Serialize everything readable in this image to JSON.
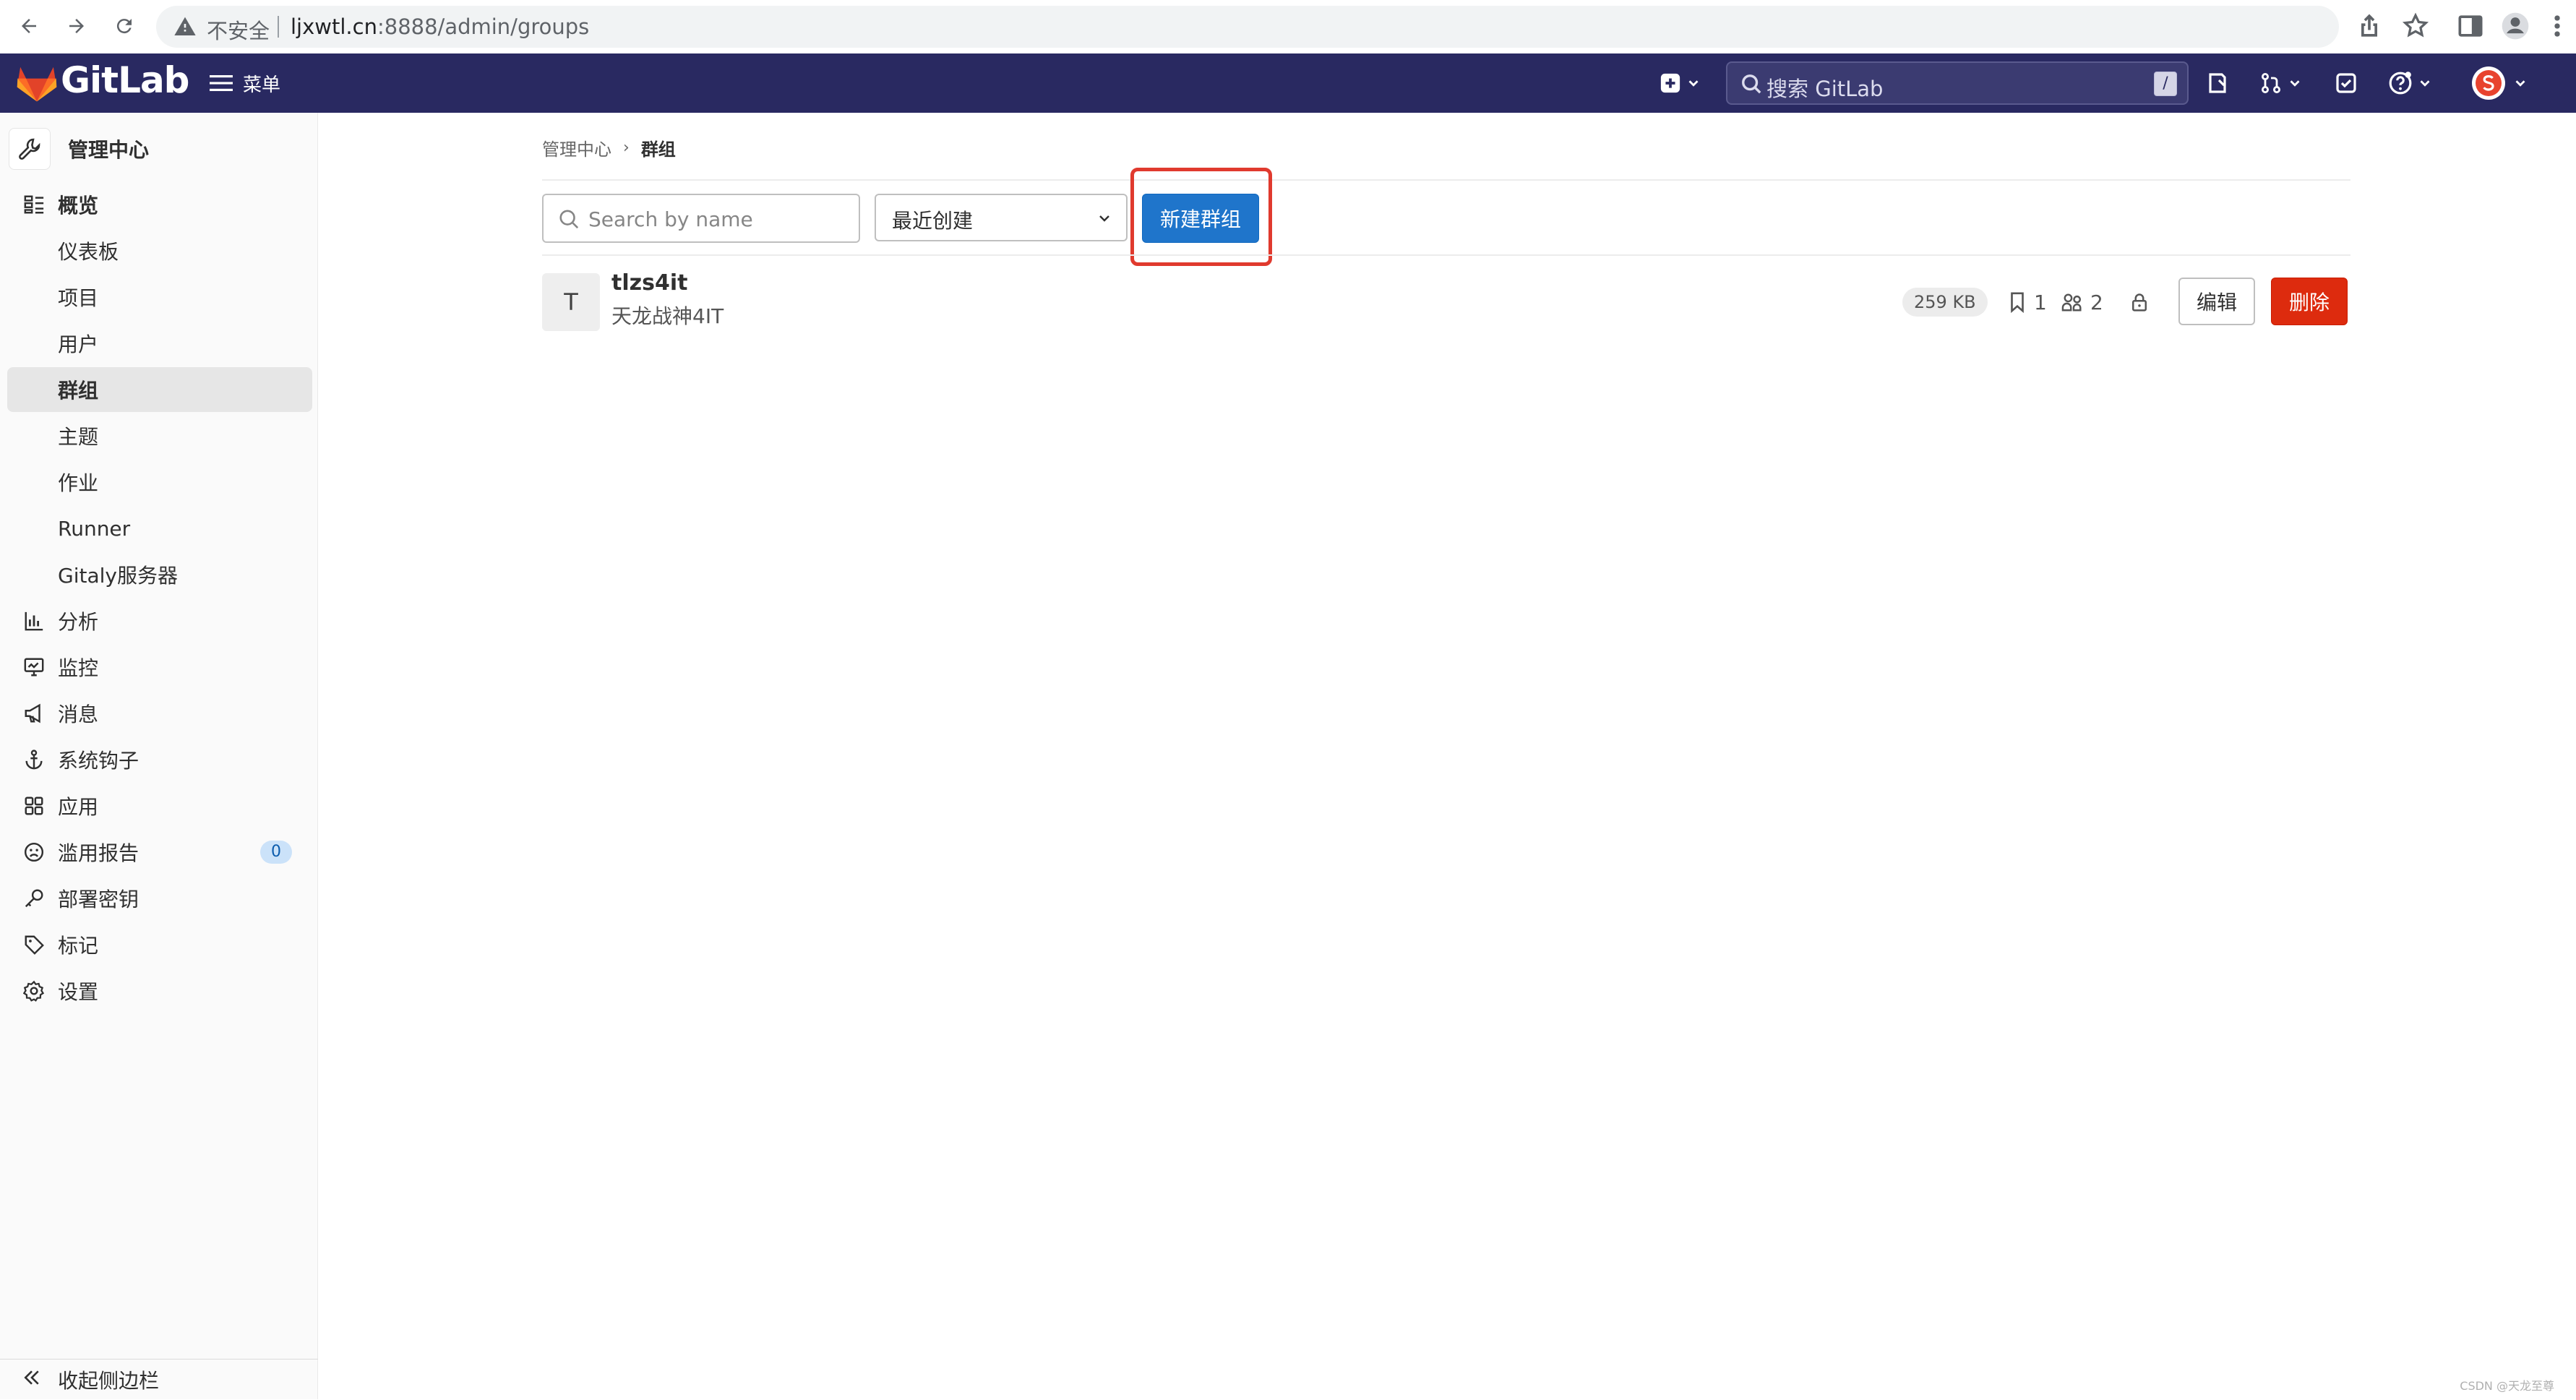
{
  "browser": {
    "security_label": "不安全",
    "url_host": "ljxwtl.cn",
    "url_rest": ":8888/admin/groups"
  },
  "header": {
    "logo_text": "GitLab",
    "menu_label": "菜单",
    "search_placeholder": "搜索 GitLab",
    "search_shortcut": "/",
    "brand_color": "#292961"
  },
  "sidebar": {
    "context_label": "管理中心",
    "items": [
      {
        "label": "概览",
        "icon": "overview-icon",
        "type": "section"
      },
      {
        "label": "仪表板",
        "type": "sub"
      },
      {
        "label": "项目",
        "type": "sub"
      },
      {
        "label": "用户",
        "type": "sub"
      },
      {
        "label": "群组",
        "type": "sub",
        "active": true
      },
      {
        "label": "主题",
        "type": "sub"
      },
      {
        "label": "作业",
        "type": "sub"
      },
      {
        "label": "Runner",
        "type": "sub"
      },
      {
        "label": "Gitaly服务器",
        "type": "sub"
      },
      {
        "label": "分析",
        "icon": "chart-icon"
      },
      {
        "label": "监控",
        "icon": "monitor-icon"
      },
      {
        "label": "消息",
        "icon": "megaphone-icon"
      },
      {
        "label": "系统钩子",
        "icon": "anchor-icon"
      },
      {
        "label": "应用",
        "icon": "applications-icon"
      },
      {
        "label": "滥用报告",
        "icon": "abuse-icon",
        "badge": "0"
      },
      {
        "label": "部署密钥",
        "icon": "key-icon"
      },
      {
        "label": "标记",
        "icon": "label-icon"
      },
      {
        "label": "设置",
        "icon": "settings-icon"
      }
    ],
    "collapse_label": "收起侧边栏"
  },
  "main": {
    "breadcrumb": {
      "parent": "管理中心",
      "current": "群组"
    },
    "filter_placeholder": "Search by name",
    "sort_selected": "最近创建",
    "new_group_label": "新建群组",
    "groups": [
      {
        "avatar_letter": "T",
        "name": "tlzs4it",
        "description": "天龙战神4IT",
        "storage_size": "259 KB",
        "projects_count": "1",
        "members_count": "2",
        "edit_label": "编辑",
        "delete_label": "删除"
      }
    ]
  },
  "watermark": "CSDN @天龙至尊"
}
